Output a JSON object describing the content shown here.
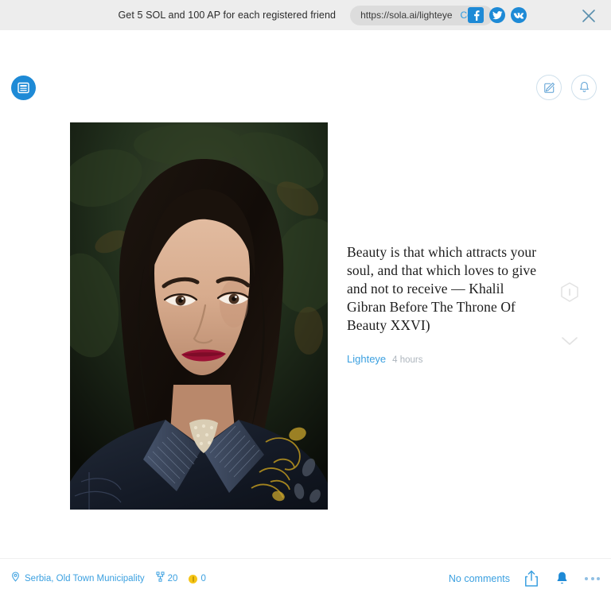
{
  "banner": {
    "message": "Get 5 SOL and 100 AP for each registered friend",
    "url": "https://sola.ai/lighteye",
    "copy_label": "Copy",
    "socials": [
      {
        "name": "facebook-share-icon",
        "glyph": "f"
      },
      {
        "name": "twitter-share-icon",
        "glyph": "t"
      },
      {
        "name": "vk-share-icon",
        "glyph": "vk"
      }
    ],
    "close_icon": "close-icon",
    "background": "#ededed",
    "accent": "#1e8ad6"
  },
  "topnav": {
    "logo_icon": "feed-logo-icon",
    "compose_icon": "compose-edit-icon",
    "notifications_icon": "bell-icon",
    "accent": "#1e8ad6",
    "outline": "#cfe0ec"
  },
  "post": {
    "image_alt": "portrait-photo",
    "quote": "Beauty is that which attracts your soul, and that which loves to give and not to receive — Khalil Gibran Before The Throne Of Beauty XXVI)",
    "author": "Lighteye",
    "timestamp": "4 hours",
    "author_color": "#3ba0e0",
    "timestamp_color": "#adb5bd",
    "side_icons": [
      {
        "name": "info-hexagon-icon"
      },
      {
        "name": "chevron-down-icon"
      }
    ]
  },
  "bottombar": {
    "location_icon": "location-pin-icon",
    "location": "Serbia, Old Town Municipality",
    "views_icon": "share-network-icon",
    "views_count": "20",
    "coin_icon": "coin-icon",
    "coin_count": "0",
    "comments_label": "No comments",
    "share_icon": "share-upload-icon",
    "bell_icon": "bell-filled-icon",
    "more_icon": "more-dots-icon",
    "accent": "#3ba0e0",
    "coin_color": "#f5c518"
  }
}
